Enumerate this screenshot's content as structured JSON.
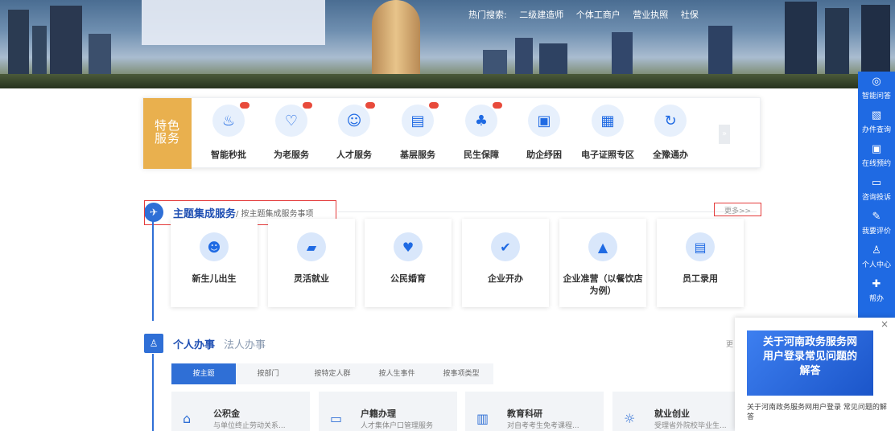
{
  "banner": {
    "hot_search_label": "热门搜索:",
    "hot_links": [
      "二级建造师",
      "个体工商户",
      "营业执照",
      "社保"
    ]
  },
  "featured": {
    "label_line1": "特色",
    "label_line2": "服务",
    "items": [
      {
        "label": "智能秒批",
        "icon": "user-gear-icon",
        "glyph": "♨",
        "badge": true
      },
      {
        "label": "为老服务",
        "icon": "heart-icon",
        "glyph": "♡",
        "badge": true
      },
      {
        "label": "人才服务",
        "icon": "people-icon",
        "glyph": "☺",
        "badge": true
      },
      {
        "label": "基层服务",
        "icon": "building-icon",
        "glyph": "▤",
        "badge": true
      },
      {
        "label": "民生保障",
        "icon": "hands-care-icon",
        "glyph": "♣",
        "badge": true
      },
      {
        "label": "助企纾困",
        "icon": "document-icon",
        "glyph": "▣",
        "badge": false
      },
      {
        "label": "电子证照专区",
        "icon": "license-icon",
        "glyph": "▦",
        "badge": false
      },
      {
        "label": "全豫通办",
        "icon": "loop-icon",
        "glyph": "↻",
        "badge": false
      }
    ],
    "more_arrow": "»"
  },
  "theme": {
    "title": "主题集成服务",
    "subtitle": "/ 按主题集成服务事项",
    "more": "更多>>",
    "cards": [
      {
        "label": "新生儿出生",
        "icon": "baby-icon",
        "glyph": "☻"
      },
      {
        "label": "灵活就业",
        "icon": "briefcase-icon",
        "glyph": "▰"
      },
      {
        "label": "公民婚育",
        "icon": "couple-icon",
        "glyph": "♥"
      },
      {
        "label": "企业开办",
        "icon": "shield-check-icon",
        "glyph": "✔"
      },
      {
        "label": "企业准营（以餐饮店为例）",
        "icon": "dish-icon",
        "glyph": "▲"
      },
      {
        "label": "员工录用",
        "icon": "id-card-icon",
        "glyph": "▤"
      }
    ]
  },
  "personal": {
    "title": "个人办事",
    "title_alt": "法人办事",
    "more": "更",
    "tabs": [
      "按主题",
      "按部门",
      "按特定人群",
      "按人生事件",
      "按事项类型"
    ],
    "tiles": [
      {
        "title": "公积金",
        "desc": "与单位终止劳动关系...",
        "icon": "house-yen-icon",
        "glyph": "⌂"
      },
      {
        "title": "户籍办理",
        "desc": "人才集体户口管理服务",
        "icon": "id-icon",
        "glyph": "▭"
      },
      {
        "title": "教育科研",
        "desc": "对自考考生免考课程...",
        "icon": "book-icon",
        "glyph": "▥"
      },
      {
        "title": "就业创业",
        "desc": "受理省外院校毕业生...",
        "icon": "bulb-icon",
        "glyph": "☼"
      }
    ]
  },
  "rail": {
    "items": [
      {
        "label": "智能问答",
        "icon": "robot-icon",
        "glyph": "◎"
      },
      {
        "label": "办件查询",
        "icon": "search-doc-icon",
        "glyph": "▧"
      },
      {
        "label": "在线预约",
        "icon": "calendar-icon",
        "glyph": "▣"
      },
      {
        "label": "咨询投诉",
        "icon": "chat-icon",
        "glyph": "▭"
      },
      {
        "label": "我要评价",
        "icon": "edit-icon",
        "glyph": "✎"
      },
      {
        "label": "个人中心",
        "icon": "person-icon",
        "glyph": "♙"
      },
      {
        "label": "帮办",
        "icon": "help-icon",
        "glyph": "✚"
      }
    ]
  },
  "popup": {
    "close": "×",
    "banner_line1": "关于河南政务服务网",
    "banner_line2": "用户登录常见问题的",
    "banner_line3": "解答",
    "text": "关于河南政务服务网用户登录 常见问题的解答"
  }
}
